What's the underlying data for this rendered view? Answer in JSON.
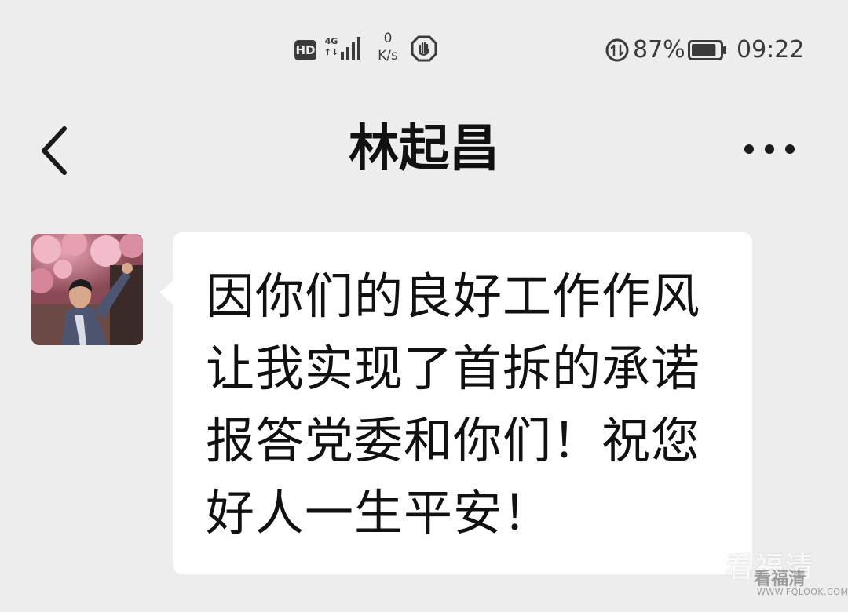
{
  "status_bar": {
    "hd_badge": "HD",
    "network_type": "4G",
    "network_arrows": "↑↓",
    "signal_icon": "cellular-signal-icon",
    "speed_value": "0",
    "speed_unit": "K/s",
    "hand_icon": "stop-hand-icon",
    "sync_icon": "data-sync-icon",
    "battery_percent": "87%",
    "battery_icon": "battery-icon",
    "battery_level": 0.87,
    "time": "09:22"
  },
  "header": {
    "back_icon": "chevron-left-icon",
    "title": "林起昌",
    "more_icon": "more-dots-icon"
  },
  "message": {
    "avatar_icon": "contact-avatar",
    "lines": [
      "因你们的良好工作作风",
      "让我实现了首拆的承诺",
      "报答党委和你们！祝您",
      "好人一生平安！"
    ]
  },
  "watermark": {
    "main": "看福清",
    "sub": "看福清",
    "url": "WWW.FQLOOK.COM"
  },
  "colors": {
    "background": "#ededed",
    "bubble": "#ffffff",
    "text": "#111111",
    "status_text": "#3b3b3b"
  }
}
